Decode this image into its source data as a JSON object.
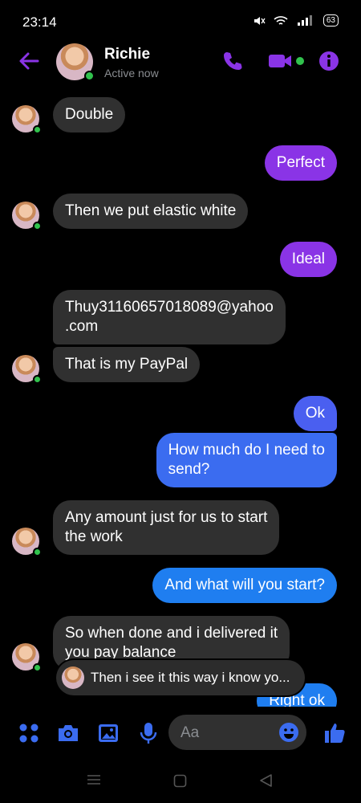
{
  "status_bar": {
    "time": "23:14",
    "battery": "63"
  },
  "header": {
    "contact_name": "Richie",
    "status": "Active now"
  },
  "messages": [
    {
      "dir": "in",
      "text": "Double"
    },
    {
      "dir": "out",
      "text": "Perfect"
    },
    {
      "dir": "in",
      "text": "Then we put elastic white"
    },
    {
      "dir": "out",
      "text": "Ideal"
    },
    {
      "dir": "in",
      "line1": "Thuy31160657018089@yahoo",
      "line2": ".com"
    },
    {
      "dir": "in",
      "text": "That is my PayPal"
    },
    {
      "dir": "out",
      "text": "Ok"
    },
    {
      "dir": "out",
      "line1": "How much do I need to",
      "line2": "send?"
    },
    {
      "dir": "in",
      "line1": "Any amount just for us to start",
      "line2": "the work"
    },
    {
      "dir": "out",
      "text": "And what will you start?"
    },
    {
      "dir": "in",
      "line1": "So when done and i delivered it",
      "line2": "you pay balance"
    },
    {
      "dir": "out",
      "text": "Right ok"
    }
  ],
  "new_message_preview": {
    "text": "Then i see it this way i know yo..."
  },
  "composer": {
    "placeholder": "Aa"
  },
  "colors": {
    "accent": "#8a34e6",
    "bubble_blue": "#3b6cf0",
    "bubble_in": "#303030",
    "online": "#31c24d"
  }
}
